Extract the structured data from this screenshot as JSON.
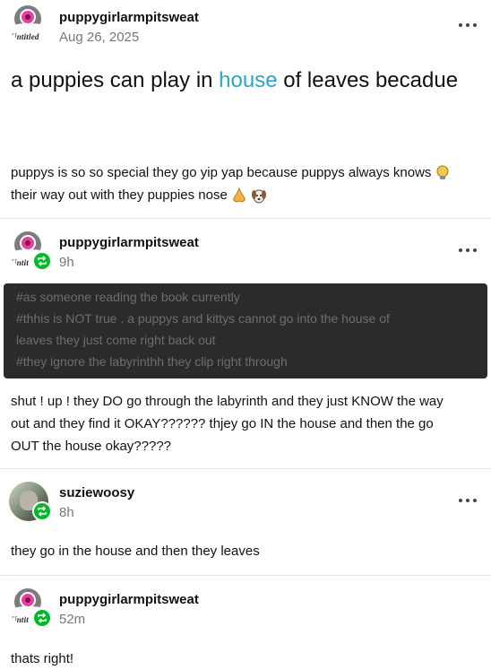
{
  "posts": [
    {
      "username": "puppygirlarmpitsweat",
      "timestamp": "Aug 26, 2025",
      "avatar_caption": "Untitled",
      "title_pre": "a puppies can play in ",
      "title_link": "house",
      "title_post": " of leaves becadue",
      "body_line1": "puppys is so so special they go yip yap because puppys always knows",
      "body_line2": "their way out with they puppies nose",
      "emoji_icons": [
        "lightbulb-icon",
        "nose-icon",
        "dog-face-icon"
      ]
    },
    {
      "username": "puppygirlarmpitsweat",
      "timestamp": "9h",
      "avatar_caption": "Untit",
      "tags": [
        "#as someone reading the book currently",
        "#thhis is NOT true . a puppys and kittys cannot go into the house of",
        "leaves they just come right back out",
        "#they ignore the labyrinthh they clip right through"
      ],
      "body_lines": [
        "shut ! up ! they DO go through the labyrinth and they just KNOW the way",
        "out and they find it OKAY?????? thjey go IN the house and then the go",
        "OUT the house okay?????"
      ]
    },
    {
      "username": "suziewoosy",
      "timestamp": "8h",
      "body": "they go in the house and then they leaves"
    },
    {
      "username": "puppygirlarmpitsweat",
      "timestamp": "52m",
      "avatar_caption": "Untit",
      "body": "thats right!"
    }
  ],
  "colors": {
    "link": "#2fa3c8",
    "reblog_badge": "#00b929",
    "tag_bg": "#2b2b2b",
    "timestamp": "#777777"
  }
}
